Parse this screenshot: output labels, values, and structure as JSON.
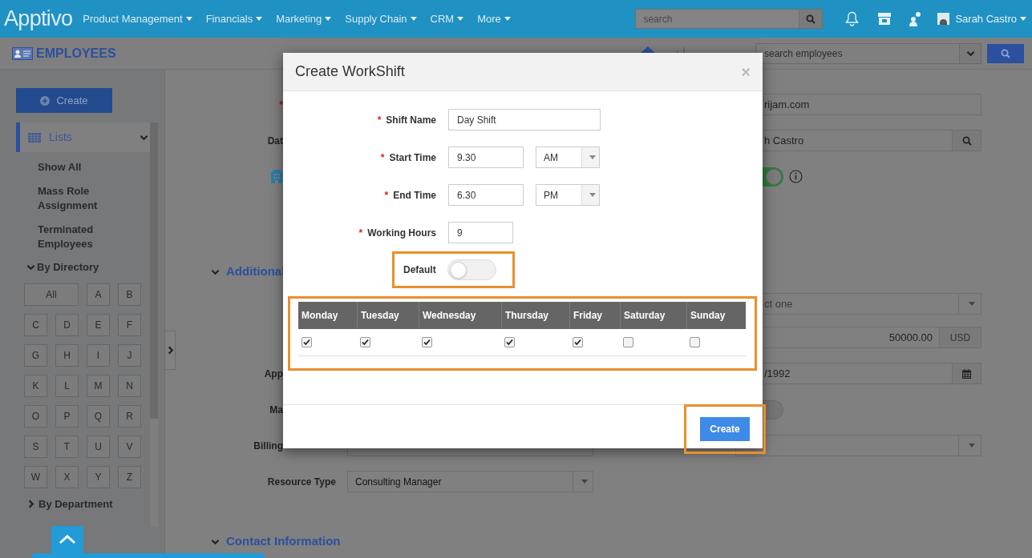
{
  "nav": {
    "logo": "Apptivo",
    "menus": [
      "Product Management",
      "Financials",
      "Marketing",
      "Supply Chain",
      "CRM",
      "More"
    ],
    "search": {
      "placeholder": "search"
    },
    "user": "Sarah Castro"
  },
  "app_bar": {
    "title": "EMPLOYEES",
    "search": {
      "placeholder": "search employees"
    }
  },
  "sidebar": {
    "create": "Create",
    "lists": {
      "label": "Lists",
      "expanded": true
    },
    "items": [
      "Show All",
      "Mass Role Assignment",
      "Terminated Employees"
    ],
    "directory": {
      "label": "By Directory",
      "expanded": true,
      "letters": [
        "All",
        "A",
        "B",
        "C",
        "D",
        "E",
        "F",
        "G",
        "H",
        "I",
        "J",
        "K",
        "L",
        "M",
        "N",
        "O",
        "P",
        "Q",
        "R",
        "S",
        "T",
        "U",
        "V",
        "W",
        "X",
        "Y",
        "Z"
      ]
    },
    "department": {
      "label": "By Department",
      "expanded": false
    }
  },
  "form": {
    "rows": [
      {
        "kind": "partial",
        "label": "*",
        "right": {
          "kind": "text",
          "value": "rijam.com"
        }
      },
      {
        "kind": "partial",
        "label": "Dat",
        "right": {
          "kind": "search",
          "value": "h Castro"
        }
      },
      {
        "kind": "partial",
        "icon": true,
        "right": {
          "kind": "toggle",
          "on": true
        }
      },
      {
        "kind": "heading",
        "label": "Additional"
      },
      {
        "kind": "partial",
        "right": {
          "kind": "select",
          "value": "ct one"
        }
      },
      {
        "kind": "partial",
        "right": {
          "kind": "money",
          "value": "50000.00",
          "unit": "USD"
        }
      },
      {
        "kind": "partial",
        "label": "App",
        "right": {
          "kind": "date",
          "value": "/1992"
        }
      },
      {
        "kind": "partial",
        "label": "Ma",
        "right": {
          "kind": "toggle",
          "on": false
        }
      },
      {
        "kind": "partial",
        "label": "Billing",
        "left": {
          "kind": "blank"
        },
        "right": {
          "kind": "select"
        }
      },
      {
        "kind": "field",
        "label": "Resource Type",
        "left": {
          "kind": "select",
          "value": "Consulting Manager"
        }
      },
      {
        "kind": "heading",
        "label": "Contact Information"
      }
    ]
  },
  "dialog": {
    "title": "Create WorkShift",
    "close": "×",
    "fields": [
      {
        "kind": "text",
        "label": "Shift Name",
        "required": true,
        "value": "Day Shift"
      },
      {
        "kind": "time",
        "label": "Start Time",
        "required": true,
        "value": "9.30",
        "period": "AM"
      },
      {
        "kind": "time",
        "label": "End Time",
        "required": true,
        "value": "6.30",
        "period": "PM"
      },
      {
        "kind": "short",
        "label": "Working Hours",
        "required": true,
        "value": "9"
      }
    ],
    "default": {
      "label": "Default",
      "on": false
    },
    "days": [
      {
        "label": "Monday",
        "checked": true
      },
      {
        "label": "Tuesday",
        "checked": true
      },
      {
        "label": "Wednesday",
        "checked": true
      },
      {
        "label": "Thursday",
        "checked": true
      },
      {
        "label": "Friday",
        "checked": true
      },
      {
        "label": "Saturday",
        "checked": false
      },
      {
        "label": "Sunday",
        "checked": false
      }
    ],
    "create": "Create"
  }
}
